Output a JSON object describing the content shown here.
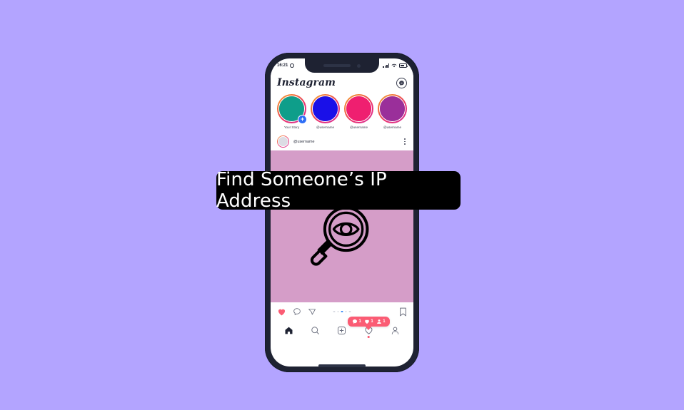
{
  "banner": {
    "title": "Find Someone’s IP Address"
  },
  "colors": {
    "page_background": "#b3a4ff",
    "phone_frame": "#1e2232",
    "post_background": "#d59dc8",
    "banner_background": "#000000",
    "banner_text": "#ffffff",
    "accent_pink": "#fb5c74",
    "badge_blue": "#2e6ef7"
  },
  "phone": {
    "statusbar": {
      "time": "16:21",
      "alarm_icon": "alarm-clock-icon",
      "signal_icon": "cellular-signal-icon",
      "wifi_icon": "wifi-icon",
      "battery_icon": "battery-icon"
    },
    "home_indicator": "home-indicator-bar"
  },
  "app": {
    "logo_text": "Instagram",
    "messenger_icon": "messenger-icon",
    "stories": [
      {
        "label": "Your Story",
        "color": "#0e9e8a",
        "has_add_badge": true,
        "add_badge": "+"
      },
      {
        "label": "@username",
        "color": "#1a10e8",
        "has_add_badge": false
      },
      {
        "label": "@username",
        "color": "#ef1f70",
        "has_add_badge": false
      },
      {
        "label": "@username",
        "color": "#9a2f9a",
        "has_add_badge": false
      }
    ],
    "post": {
      "username": "@username",
      "avatar_icon": "user-avatar",
      "more_options_icon": "more-options-icon",
      "media_icon": "magnifier-eye-icon",
      "actions": {
        "like_icon": "heart-filled-icon",
        "comment_icon": "comment-bubble-icon",
        "share_icon": "share-paper-plane-icon",
        "save_icon": "bookmark-icon",
        "page_dots": 5,
        "active_dot_index": 2
      },
      "counts_tooltip": [
        {
          "icon": "comment-count-icon",
          "value": "1"
        },
        {
          "icon": "heart-count-icon",
          "value": "1"
        },
        {
          "icon": "follower-count-icon",
          "value": "1"
        }
      ]
    },
    "bottom_nav": [
      {
        "name": "home",
        "icon": "home-icon",
        "active": true,
        "has_dot": false
      },
      {
        "name": "search",
        "icon": "search-icon",
        "active": false,
        "has_dot": false
      },
      {
        "name": "add-post",
        "icon": "add-post-icon",
        "active": false,
        "has_dot": false
      },
      {
        "name": "activity",
        "icon": "heart-outline-icon",
        "active": false,
        "has_dot": true
      },
      {
        "name": "profile",
        "icon": "profile-icon",
        "active": false,
        "has_dot": false
      }
    ]
  }
}
